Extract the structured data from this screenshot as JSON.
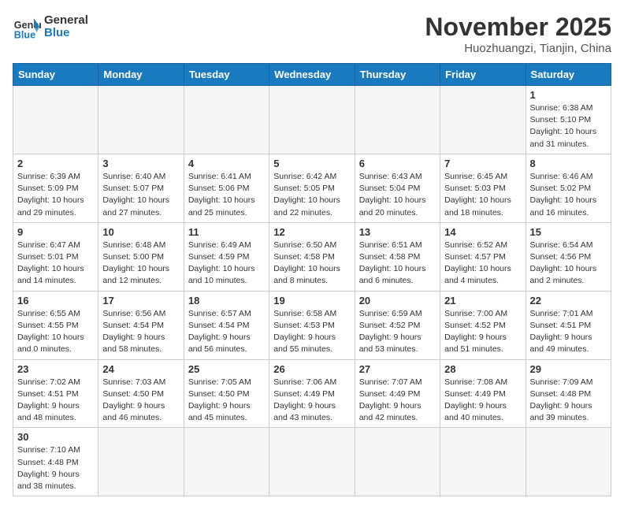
{
  "logo": {
    "text_general": "General",
    "text_blue": "Blue"
  },
  "title": "November 2025",
  "location": "Huozhuangzi, Tianjin, China",
  "weekdays": [
    "Sunday",
    "Monday",
    "Tuesday",
    "Wednesday",
    "Thursday",
    "Friday",
    "Saturday"
  ],
  "weeks": [
    [
      {
        "day": "",
        "info": ""
      },
      {
        "day": "",
        "info": ""
      },
      {
        "day": "",
        "info": ""
      },
      {
        "day": "",
        "info": ""
      },
      {
        "day": "",
        "info": ""
      },
      {
        "day": "",
        "info": ""
      },
      {
        "day": "1",
        "info": "Sunrise: 6:38 AM\nSunset: 5:10 PM\nDaylight: 10 hours and 31 minutes."
      }
    ],
    [
      {
        "day": "2",
        "info": "Sunrise: 6:39 AM\nSunset: 5:09 PM\nDaylight: 10 hours and 29 minutes."
      },
      {
        "day": "3",
        "info": "Sunrise: 6:40 AM\nSunset: 5:07 PM\nDaylight: 10 hours and 27 minutes."
      },
      {
        "day": "4",
        "info": "Sunrise: 6:41 AM\nSunset: 5:06 PM\nDaylight: 10 hours and 25 minutes."
      },
      {
        "day": "5",
        "info": "Sunrise: 6:42 AM\nSunset: 5:05 PM\nDaylight: 10 hours and 22 minutes."
      },
      {
        "day": "6",
        "info": "Sunrise: 6:43 AM\nSunset: 5:04 PM\nDaylight: 10 hours and 20 minutes."
      },
      {
        "day": "7",
        "info": "Sunrise: 6:45 AM\nSunset: 5:03 PM\nDaylight: 10 hours and 18 minutes."
      },
      {
        "day": "8",
        "info": "Sunrise: 6:46 AM\nSunset: 5:02 PM\nDaylight: 10 hours and 16 minutes."
      }
    ],
    [
      {
        "day": "9",
        "info": "Sunrise: 6:47 AM\nSunset: 5:01 PM\nDaylight: 10 hours and 14 minutes."
      },
      {
        "day": "10",
        "info": "Sunrise: 6:48 AM\nSunset: 5:00 PM\nDaylight: 10 hours and 12 minutes."
      },
      {
        "day": "11",
        "info": "Sunrise: 6:49 AM\nSunset: 4:59 PM\nDaylight: 10 hours and 10 minutes."
      },
      {
        "day": "12",
        "info": "Sunrise: 6:50 AM\nSunset: 4:58 PM\nDaylight: 10 hours and 8 minutes."
      },
      {
        "day": "13",
        "info": "Sunrise: 6:51 AM\nSunset: 4:58 PM\nDaylight: 10 hours and 6 minutes."
      },
      {
        "day": "14",
        "info": "Sunrise: 6:52 AM\nSunset: 4:57 PM\nDaylight: 10 hours and 4 minutes."
      },
      {
        "day": "15",
        "info": "Sunrise: 6:54 AM\nSunset: 4:56 PM\nDaylight: 10 hours and 2 minutes."
      }
    ],
    [
      {
        "day": "16",
        "info": "Sunrise: 6:55 AM\nSunset: 4:55 PM\nDaylight: 10 hours and 0 minutes."
      },
      {
        "day": "17",
        "info": "Sunrise: 6:56 AM\nSunset: 4:54 PM\nDaylight: 9 hours and 58 minutes."
      },
      {
        "day": "18",
        "info": "Sunrise: 6:57 AM\nSunset: 4:54 PM\nDaylight: 9 hours and 56 minutes."
      },
      {
        "day": "19",
        "info": "Sunrise: 6:58 AM\nSunset: 4:53 PM\nDaylight: 9 hours and 55 minutes."
      },
      {
        "day": "20",
        "info": "Sunrise: 6:59 AM\nSunset: 4:52 PM\nDaylight: 9 hours and 53 minutes."
      },
      {
        "day": "21",
        "info": "Sunrise: 7:00 AM\nSunset: 4:52 PM\nDaylight: 9 hours and 51 minutes."
      },
      {
        "day": "22",
        "info": "Sunrise: 7:01 AM\nSunset: 4:51 PM\nDaylight: 9 hours and 49 minutes."
      }
    ],
    [
      {
        "day": "23",
        "info": "Sunrise: 7:02 AM\nSunset: 4:51 PM\nDaylight: 9 hours and 48 minutes."
      },
      {
        "day": "24",
        "info": "Sunrise: 7:03 AM\nSunset: 4:50 PM\nDaylight: 9 hours and 46 minutes."
      },
      {
        "day": "25",
        "info": "Sunrise: 7:05 AM\nSunset: 4:50 PM\nDaylight: 9 hours and 45 minutes."
      },
      {
        "day": "26",
        "info": "Sunrise: 7:06 AM\nSunset: 4:49 PM\nDaylight: 9 hours and 43 minutes."
      },
      {
        "day": "27",
        "info": "Sunrise: 7:07 AM\nSunset: 4:49 PM\nDaylight: 9 hours and 42 minutes."
      },
      {
        "day": "28",
        "info": "Sunrise: 7:08 AM\nSunset: 4:49 PM\nDaylight: 9 hours and 40 minutes."
      },
      {
        "day": "29",
        "info": "Sunrise: 7:09 AM\nSunset: 4:48 PM\nDaylight: 9 hours and 39 minutes."
      }
    ],
    [
      {
        "day": "30",
        "info": "Sunrise: 7:10 AM\nSunset: 4:48 PM\nDaylight: 9 hours and 38 minutes."
      },
      {
        "day": "",
        "info": ""
      },
      {
        "day": "",
        "info": ""
      },
      {
        "day": "",
        "info": ""
      },
      {
        "day": "",
        "info": ""
      },
      {
        "day": "",
        "info": ""
      },
      {
        "day": "",
        "info": ""
      }
    ]
  ]
}
